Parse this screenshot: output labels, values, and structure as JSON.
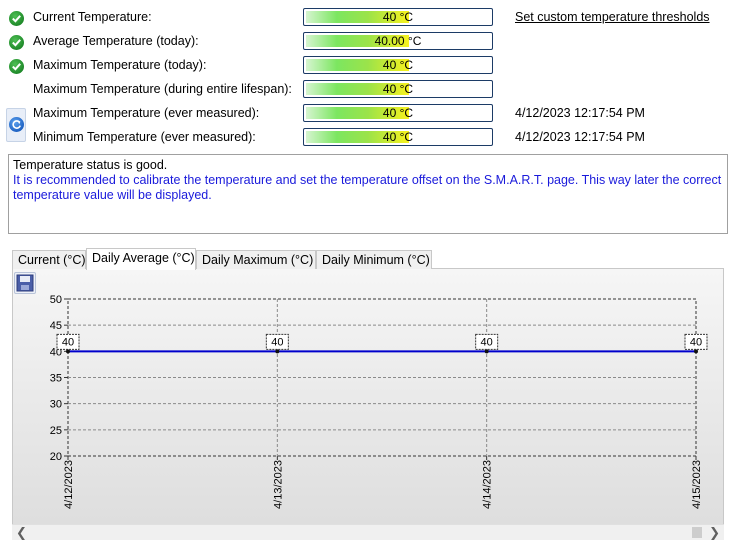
{
  "rows": [
    {
      "label": "Current Temperature:",
      "value": "40 °C",
      "fill": 0.56,
      "status": "ok",
      "timestamp": ""
    },
    {
      "label": "Average Temperature (today):",
      "value": "40.00 °C",
      "fill": 0.56,
      "status": "ok",
      "timestamp": ""
    },
    {
      "label": "Maximum Temperature (today):",
      "value": "40 °C",
      "fill": 0.56,
      "status": "ok",
      "timestamp": ""
    },
    {
      "label": "Maximum Temperature (during entire lifespan):",
      "value": "40 °C",
      "fill": 0.56,
      "status": "none",
      "timestamp": ""
    },
    {
      "label": "Maximum Temperature (ever measured):",
      "value": "40 °C",
      "fill": 0.56,
      "status": "none",
      "timestamp": "4/12/2023 12:17:54 PM"
    },
    {
      "label": "Minimum Temperature (ever measured):",
      "value": "40 °C",
      "fill": 0.56,
      "status": "none",
      "timestamp": "4/12/2023 12:17:54 PM"
    }
  ],
  "thresholds_link": "Set custom temperature thresholds",
  "status": {
    "line1": "Temperature status is good.",
    "line2": "It is recommended to calibrate the temperature and set the temperature offset on the S.M.A.R.T. page. This way later the correct temperature value will be displayed."
  },
  "tabs": [
    {
      "label": "Current (°C)",
      "active": false
    },
    {
      "label": "Daily Average (°C)",
      "active": true
    },
    {
      "label": "Daily Maximum (°C)",
      "active": false
    },
    {
      "label": "Daily Minimum (°C)",
      "active": false
    }
  ],
  "icons": {
    "ok": "check-circle-icon",
    "refresh": "refresh-icon",
    "save": "save-disk-icon"
  },
  "colors": {
    "series": "#0000cc",
    "link": "#1a1adb"
  },
  "chart_data": {
    "type": "line",
    "x": [
      "4/12/2023",
      "4/13/2023",
      "4/14/2023",
      "4/15/2023"
    ],
    "series": [
      {
        "values": [
          40,
          40,
          40,
          40
        ]
      }
    ],
    "data_labels": [
      "40",
      "40",
      "40",
      "40"
    ],
    "ylim": [
      20,
      50
    ],
    "yticks": [
      20,
      25,
      30,
      35,
      40,
      45,
      50
    ],
    "grid": true
  }
}
